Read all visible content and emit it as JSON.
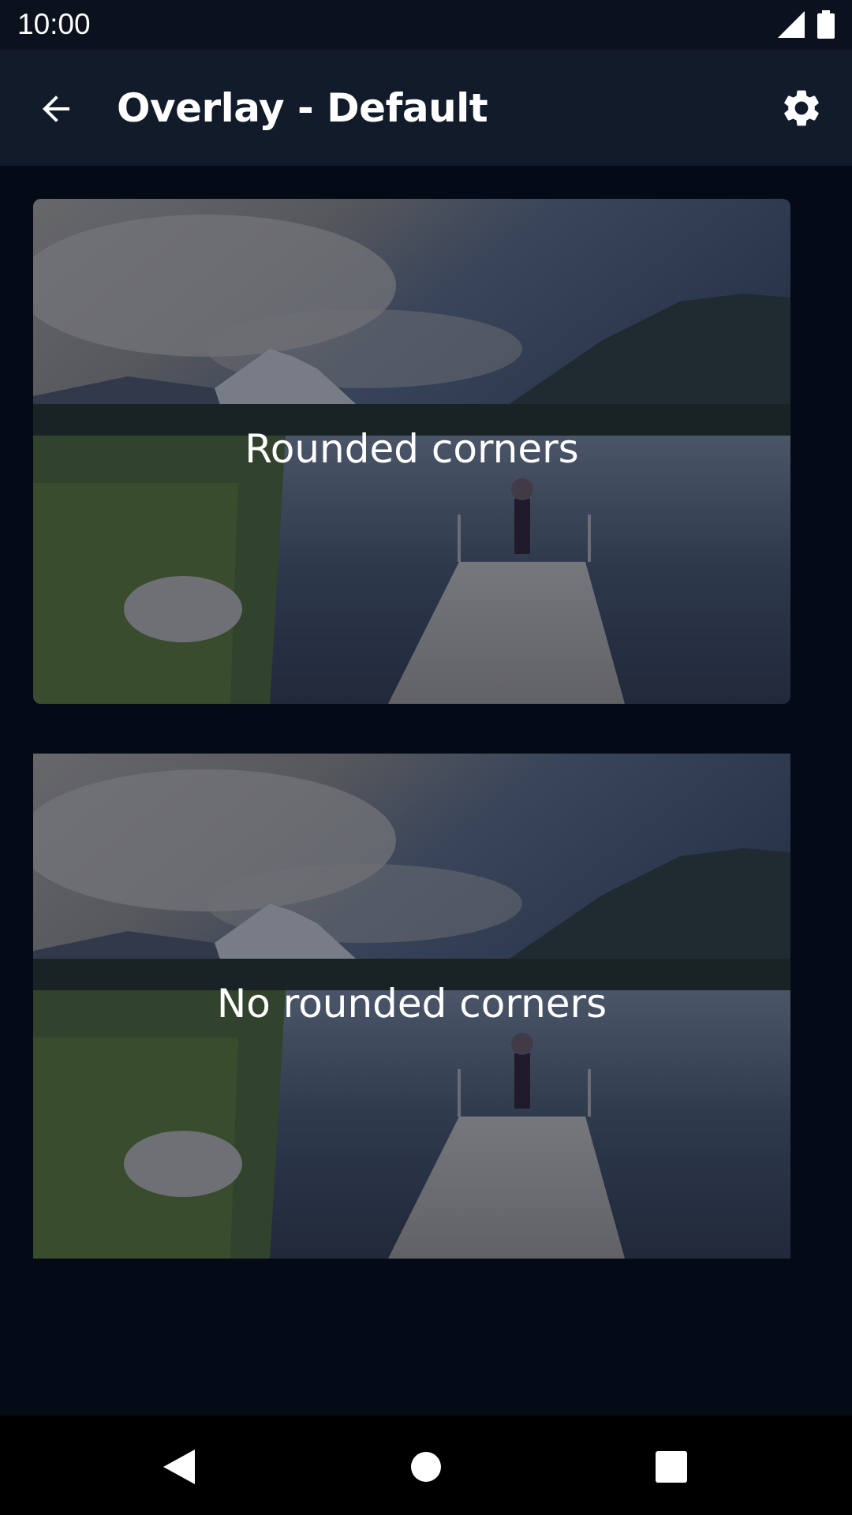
{
  "status_bar": {
    "time": "10:00",
    "signal_icon": "signal-icon",
    "battery_icon": "battery-icon"
  },
  "app_bar": {
    "title": "Overlay - Default",
    "back_icon": "arrow-back-icon",
    "settings_icon": "gear-icon"
  },
  "cards": [
    {
      "label": "Rounded corners",
      "image": "lake-mountain-dock-photo"
    },
    {
      "label": "No rounded corners",
      "image": "lake-mountain-dock-photo"
    }
  ],
  "nav_bar": {
    "back_icon": "triangle-back-icon",
    "home_icon": "circle-home-icon",
    "recents_icon": "square-recents-icon"
  },
  "colors": {
    "background": "#050b16",
    "app_bar": "#121b2a",
    "status_bar": "#0b111d",
    "overlay": "#050c1e"
  }
}
